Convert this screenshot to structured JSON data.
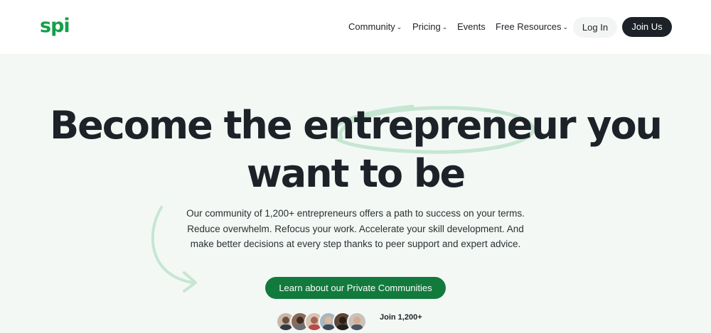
{
  "header": {
    "logo": "spi",
    "nav": [
      {
        "label": "Community",
        "has_dropdown": true
      },
      {
        "label": "Pricing",
        "has_dropdown": true
      },
      {
        "label": "Events",
        "has_dropdown": false
      },
      {
        "label": "Free Resources",
        "has_dropdown": true
      }
    ],
    "login_label": "Log In",
    "join_label": "Join Us"
  },
  "hero": {
    "title_line1": "Become the entrepreneur you",
    "title_line2": "want to be",
    "subtitle": "Our community of 1,200+ entrepreneurs offers a path to success on your terms. Reduce overwhelm. Refocus your work. Accelerate your skill development. And make better decisions at every step thanks to peer support and expert advice.",
    "cta_label": "Learn about our Private Communities",
    "join_text": "Join 1,200+"
  },
  "colors": {
    "brand_green": "#14a04a",
    "cta_green": "#127a3c",
    "dark": "#1c2227",
    "hero_bg": "#f3f8f5"
  }
}
